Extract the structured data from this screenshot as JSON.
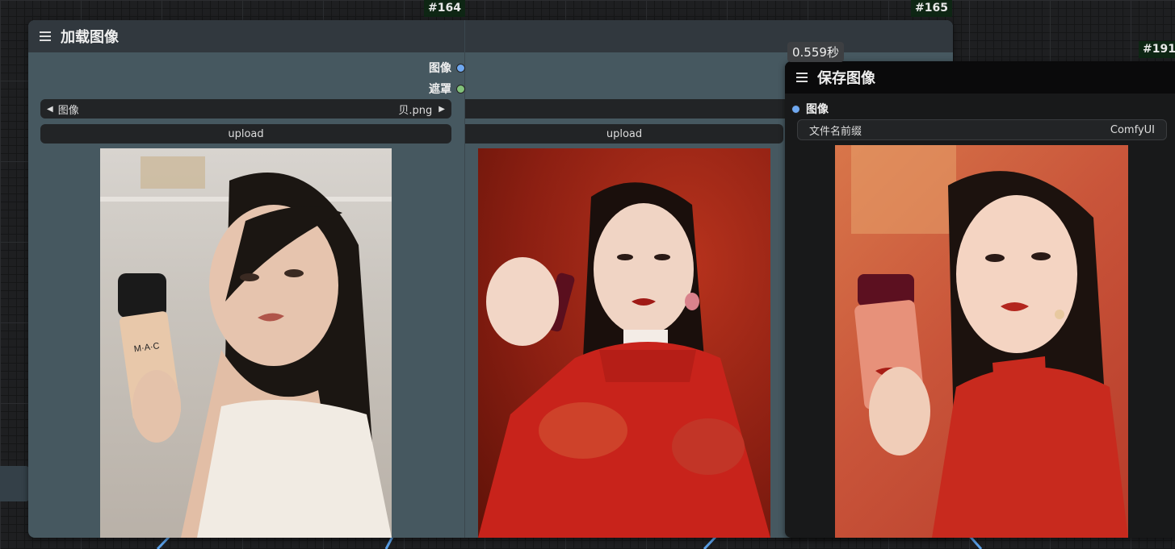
{
  "nodes": {
    "load": {
      "id": "#164",
      "title": "加载图像",
      "outputs": [
        {
          "label": "图像",
          "color": "#6fa8f0"
        },
        {
          "label": "遮罩",
          "color": "#82c27a"
        }
      ],
      "image_widget": {
        "label": "图像",
        "value": "贝.png"
      },
      "upload_label": "upload",
      "preview": "woman holding MAC Studio Fix foundation bottle, white camisole"
    },
    "load2": {
      "id": "#165",
      "upload_label": "upload",
      "preview": "woman in red qipao holding dark red lipstick"
    },
    "save": {
      "id": "#191",
      "title": "保存图像",
      "timing": "0.559秒",
      "input": {
        "label": "图像",
        "color": "#6fa8f0"
      },
      "prefix_widget": {
        "label": "文件名前缀",
        "value": "ComfyUI"
      },
      "preview": "woman in red qipao holding red foundation bottle with goldfish"
    }
  },
  "icons": [
    "menu-icon",
    "arrow-left-icon",
    "arrow-right-icon"
  ],
  "colors": {
    "canvas": "#1e1f21",
    "node_body": "#465860",
    "node_header": "#31383e",
    "save_body": "#18191a",
    "id_badge": "#0e2614",
    "wire": "#5aa0e8"
  }
}
